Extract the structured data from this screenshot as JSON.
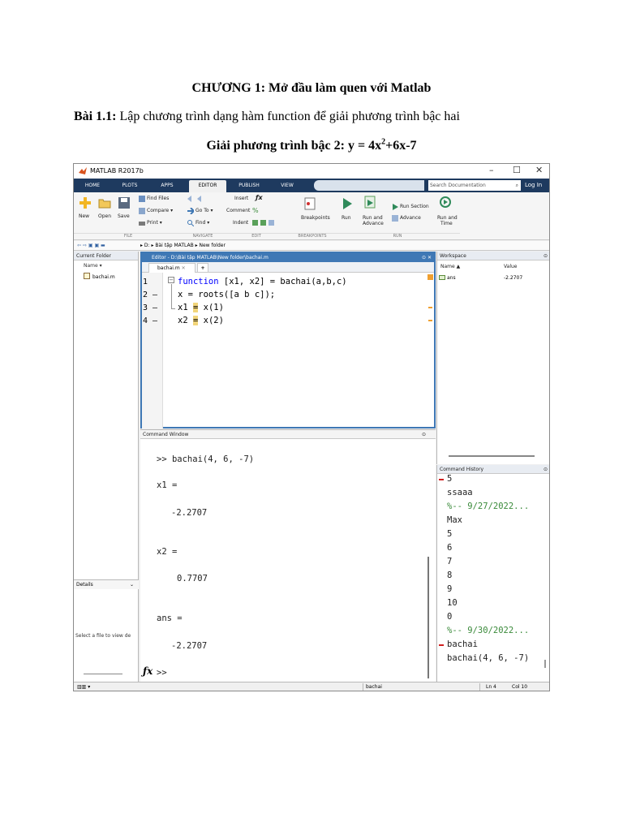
{
  "document": {
    "title": "CHƯƠNG 1: Mở đầu làm quen với Matlab",
    "exercise_label": "Bài 1.1:",
    "exercise_text": " Lập chương trình dạng hàm function để giải phương trình bậc hai",
    "subtitle_main": "Giải phương trình bậc 2: y = 4x",
    "subtitle_sup": "2",
    "subtitle_tail": "+6x-7"
  },
  "window": {
    "title": "MATLAB R2017b",
    "controls": [
      "–",
      "☐",
      "✕"
    ]
  },
  "tabs": [
    "HOME",
    "PLOTS",
    "APPS",
    "EDITOR",
    "PUBLISH",
    "VIEW"
  ],
  "active_tab": "EDITOR",
  "search": {
    "placeholder": "Search Documentation",
    "login": "Log In"
  },
  "ribbon": {
    "file": {
      "new": "New",
      "open": "Open",
      "save": "Save",
      "find_files": "Find Files",
      "compare": "Compare ▾",
      "print": "Print ▾",
      "section": "FILE"
    },
    "navigate": {
      "goto": "Go To ▾",
      "find": "Find ▾",
      "section": "NAVIGATE"
    },
    "edit": {
      "insert": "Insert",
      "comment": "Comment",
      "indent": "Indent",
      "section": "EDIT"
    },
    "breakpoints": {
      "label": "Breakpoints",
      "section": "BREAKPOINTS"
    },
    "run": {
      "run": "Run",
      "run_advance_1": "Run and",
      "run_advance_2": "Advance",
      "run_section": "Run Section",
      "advance": "Advance",
      "run_time_1": "Run and",
      "run_time_2": "Time",
      "section": "RUN"
    }
  },
  "path": {
    "crumbs": "▸ D: ▸ Bài tập MATLAB ▸ New folder"
  },
  "current_folder": {
    "title": "Current Folder",
    "column": "Name ▾",
    "files": [
      "bachai.m"
    ],
    "details": "Details",
    "details_msg": "Select a file to view de"
  },
  "editor": {
    "title": "Editor - D:\\Bài tập MATLAB\\New folder\\bachai.m",
    "tab": "bachai.m",
    "line_numbers": [
      "1",
      "2 —",
      "3 —",
      "4 —"
    ],
    "lines": {
      "l1_kw": "function",
      "l1_rest": " [x1, x2] = bachai(a,b,c)",
      "l2": "x = roots([a b c]);",
      "l3_a": "x1 ",
      "l3_eq": "=",
      "l3_b": " x(1)",
      "l4_a": "x2 ",
      "l4_eq": "=",
      "l4_b": " x(2)"
    }
  },
  "command_window": {
    "title": "Command Window",
    "lines": [
      ">> bachai(4, 6, -7)",
      "x1 =",
      "-2.2707",
      "x2 =",
      "0.7707",
      "ans =",
      "-2.2707",
      ">>"
    ]
  },
  "workspace": {
    "title": "Workspace",
    "columns": [
      "Name ▲",
      "Value"
    ],
    "rows": [
      {
        "name": "ans",
        "value": "-2.2707"
      }
    ]
  },
  "history": {
    "title": "Command History",
    "items": [
      "5",
      "ssaaa",
      "%-- 9/27/2022...",
      "Max",
      "5",
      "6",
      "7",
      "8",
      "9",
      "10",
      "0",
      "%-- 9/30/2022...",
      "bachai",
      "bachai(4, 6, -7)"
    ]
  },
  "status": {
    "left": "▥▥ ▾",
    "file": "bachai",
    "ln": "Ln  4",
    "col": "Col  10"
  },
  "colors": {
    "accent": "#3f78b5",
    "tabbar": "#1e3a5f",
    "keyword": "#0000ff",
    "highlight": "#f2d57a"
  }
}
